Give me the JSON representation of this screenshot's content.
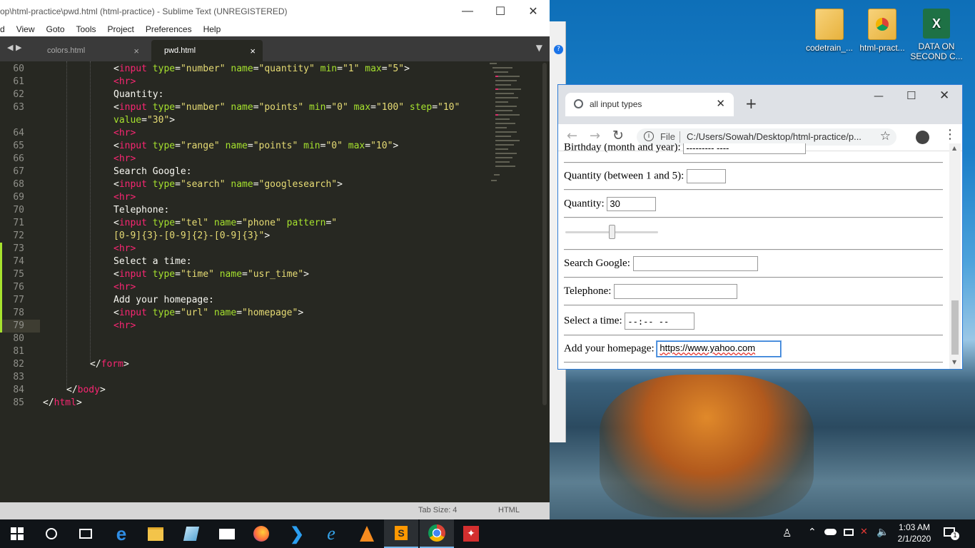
{
  "sublime": {
    "title": "op\\html-practice\\pwd.html (html-practice) - Sublime Text (UNREGISTERED)",
    "menu": [
      "d",
      "View",
      "Goto",
      "Tools",
      "Project",
      "Preferences",
      "Help"
    ],
    "tabs": [
      {
        "label": "colors.html"
      },
      {
        "label": "pwd.html"
      }
    ],
    "status": {
      "tab_size": "Tab Size: 4",
      "syntax": "HTML"
    },
    "code": {
      "l60": {
        "num": "60",
        "t1": "<",
        "t2": "input",
        "a1": "type",
        "eq1": "=",
        "s1": "\"number\"",
        "a2": "name",
        "eq2": "=",
        "s2": "\"quantity\"",
        "a3": "min",
        "eq3": "=",
        "s3": "\"1\"",
        "a4": "max",
        "eq4": "=",
        "s4": "\"5\"",
        "end": ">"
      },
      "l61": {
        "num": "61",
        "text": "<hr>"
      },
      "l62": {
        "num": "62",
        "text": "Quantity:"
      },
      "l63": {
        "num": "63",
        "t2": "input",
        "a1": "type",
        "s1": "\"number\"",
        "a2": "name",
        "s2": "\"points\"",
        "a3": "min",
        "s3": "\"0\"",
        "a4": "max",
        "s4": "\"100\"",
        "a5": "step",
        "s5": "\"10\""
      },
      "l63b": {
        "a": "value",
        "s": "\"30\""
      },
      "l64": {
        "num": "64",
        "text": "<hr>"
      },
      "l65": {
        "num": "65",
        "t2": "input",
        "a1": "type",
        "s1": "\"range\"",
        "a2": "name",
        "s2": "\"points\"",
        "a3": "min",
        "s3": "\"0\"",
        "a4": "max",
        "s4": "\"10\""
      },
      "l66": {
        "num": "66",
        "text": "<hr>"
      },
      "l67": {
        "num": "67",
        "text": "Search Google:"
      },
      "l68": {
        "num": "68",
        "t2": "input",
        "a1": "type",
        "s1": "\"search\"",
        "a2": "name",
        "s2": "\"googlesearch\""
      },
      "l69": {
        "num": "69",
        "text": "<hr>"
      },
      "l70": {
        "num": "70",
        "text": "Telephone:"
      },
      "l71": {
        "num": "71",
        "t2": "input",
        "a1": "type",
        "s1": "\"tel\"",
        "a2": "name",
        "s2": "\"phone\"",
        "a3": "pattern",
        "s3": "\""
      },
      "l72": {
        "num": "72",
        "s": "[0-9]{3}-[0-9]{2}-[0-9]{3}\"",
        "end": ">"
      },
      "l73": {
        "num": "73",
        "text": "<hr>"
      },
      "l74": {
        "num": "74",
        "text": "Select a time:"
      },
      "l75": {
        "num": "75",
        "t2": "input",
        "a1": "type",
        "s1": "\"time\"",
        "a2": "name",
        "s2": "\"usr_time\""
      },
      "l76": {
        "num": "76",
        "text": "<hr>"
      },
      "l77": {
        "num": "77",
        "text": "Add your homepage:"
      },
      "l78": {
        "num": "78",
        "t2": "input",
        "a1": "type",
        "s1": "\"url\"",
        "a2": "name",
        "s2": "\"homepage\""
      },
      "l79": {
        "num": "79",
        "text": "<hr>"
      },
      "l80": {
        "num": "80"
      },
      "l81": {
        "num": "81"
      },
      "l82": {
        "num": "82",
        "tag": "form"
      },
      "l83": {
        "num": "83"
      },
      "l84": {
        "num": "84",
        "tag": "body"
      },
      "l85": {
        "num": "85",
        "tag": "html"
      }
    }
  },
  "chrome": {
    "tab_title": "all input types",
    "address_scheme": "File",
    "address": "C:/Users/Sowah/Desktop/html-practice/p...",
    "page": {
      "birthday_label": "Birthday (month and year):",
      "birthday_value": "---------  ----",
      "quantity5_label": "Quantity (between 1 and 5):",
      "quantity_label": "Quantity:",
      "quantity_value": "30",
      "range_value": 0.5,
      "search_label": "Search Google:",
      "telephone_label": "Telephone:",
      "time_label": "Select a time:",
      "time_value": "--:--  --",
      "homepage_label": "Add your homepage:",
      "homepage_value": "https://www.yahoo.com"
    }
  },
  "desktop": {
    "icons": [
      {
        "label": "codetrain_...",
        "icon": "folder-icon"
      },
      {
        "label": "html-pract...",
        "icon": "chrome-file-icon"
      },
      {
        "label": "DATA ON SECOND C...",
        "icon": "excel-icon"
      }
    ]
  },
  "taskbar": {
    "time": "1:03 AM",
    "date": "2/1/2020",
    "notification_count": "1",
    "apps": [
      "start",
      "search",
      "task-view",
      "edge",
      "file-explorer",
      "notepad",
      "mail",
      "firefox",
      "vscode",
      "internet-explorer",
      "vlc",
      "sublime",
      "chrome",
      "acrobat"
    ]
  },
  "colors": {
    "editor_bg": "#272822",
    "tag": "#f92672",
    "attr": "#a6e22e",
    "string": "#e6db74",
    "taskbar": "#101418"
  }
}
